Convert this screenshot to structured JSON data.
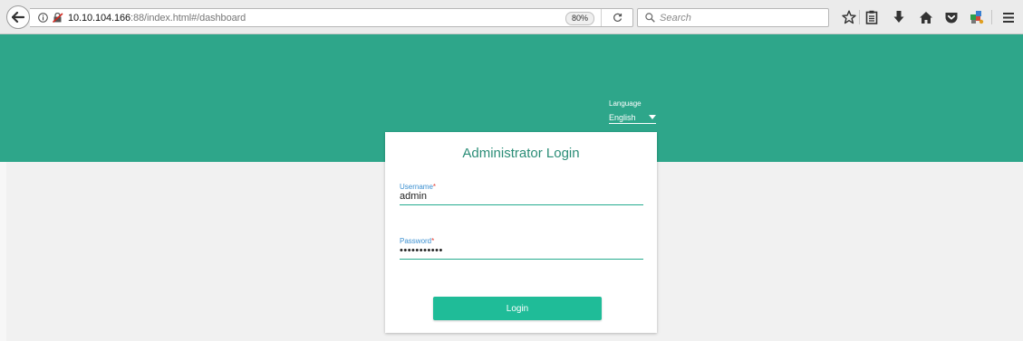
{
  "browser": {
    "url_host": "10.10.104.166",
    "url_rest": ":88/index.html#/dashboard",
    "zoom": "80%",
    "search_placeholder": "Search"
  },
  "icons": {
    "back": "back-arrow-icon",
    "info": "info-icon",
    "insecure_lock": "insecure-lock-icon",
    "reload": "reload-icon",
    "search": "search-icon",
    "bookmark": "star-icon",
    "reading_list": "clipboard-icon",
    "downloads": "download-icon",
    "home": "home-icon",
    "pocket": "pocket-icon",
    "extension": "extension-icon",
    "menu": "hamburger-menu-icon"
  },
  "colors": {
    "brand": "#2ea68a",
    "button": "#1fbc98",
    "title": "#2b8d77",
    "label": "#3a8fd0",
    "required": "#e23a2f"
  },
  "language": {
    "label": "Language",
    "selected": "English"
  },
  "login": {
    "title": "Administrator Login",
    "username_label": "Username",
    "username_value": "admin",
    "password_label": "Password",
    "password_value": "•••••••••••",
    "required_mark": "*",
    "button_label": "Login"
  }
}
